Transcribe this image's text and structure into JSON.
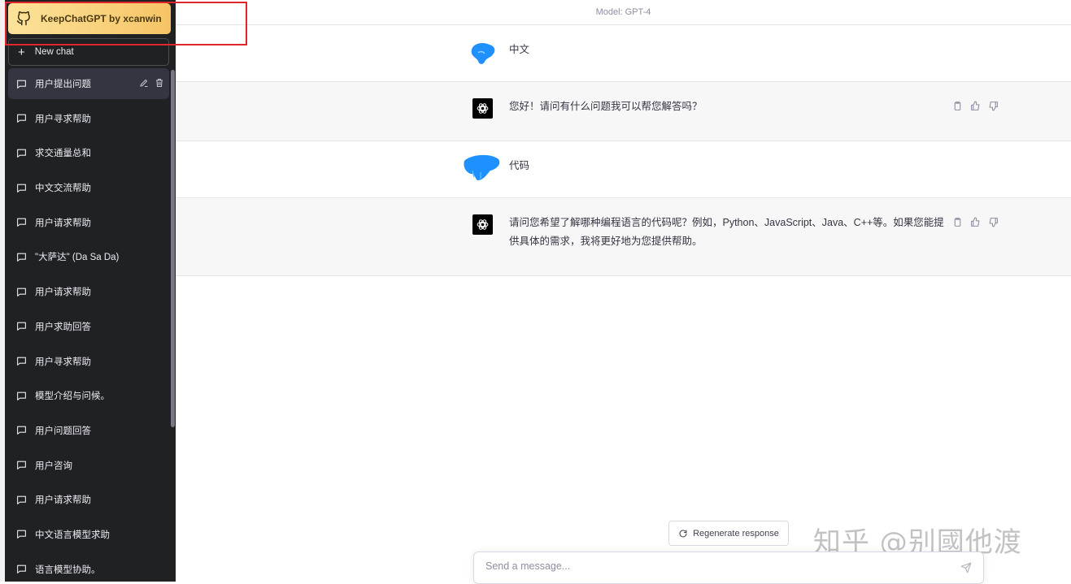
{
  "brand": {
    "title": "KeepChatGPT by xcanwin",
    "icon": "github-icon"
  },
  "sidebar": {
    "new_chat_label": "New chat",
    "items": [
      {
        "label": "用户提出问题",
        "active": true
      },
      {
        "label": "用户寻求帮助"
      },
      {
        "label": "求交通量总和"
      },
      {
        "label": "中文交流帮助"
      },
      {
        "label": "用户请求帮助"
      },
      {
        "label": "\"大萨达\" (Da Sa Da)"
      },
      {
        "label": "用户请求帮助"
      },
      {
        "label": "用户求助回答"
      },
      {
        "label": "用户寻求帮助"
      },
      {
        "label": "模型介绍与问候。"
      },
      {
        "label": "用户问题回答"
      },
      {
        "label": "用户咨询"
      },
      {
        "label": "用户请求帮助"
      },
      {
        "label": "中文语言模型求助"
      },
      {
        "label": "语言模型协助。"
      }
    ]
  },
  "header": {
    "model_label": "Model: GPT-4"
  },
  "messages": [
    {
      "role": "user",
      "text": "中文"
    },
    {
      "role": "assistant",
      "text": "您好！请问有什么问题我可以帮您解答吗？"
    },
    {
      "role": "user",
      "text": "代码"
    },
    {
      "role": "assistant",
      "text": "请问您希望了解哪种编程语言的代码呢？例如，Python、JavaScript、Java、C++等。如果您能提供具体的需求，我将更好地为您提供帮助。"
    }
  ],
  "composer": {
    "regenerate_label": "Regenerate response",
    "placeholder": "Send a message..."
  },
  "watermark": "知乎 @别國他渡",
  "colors": {
    "sidebar_bg": "#202123",
    "brand_bg": "#f6c466",
    "assistant_bg": "#f7f7f8",
    "annotation_red": "#e0262b",
    "user_avatar": "#1e90ff"
  }
}
